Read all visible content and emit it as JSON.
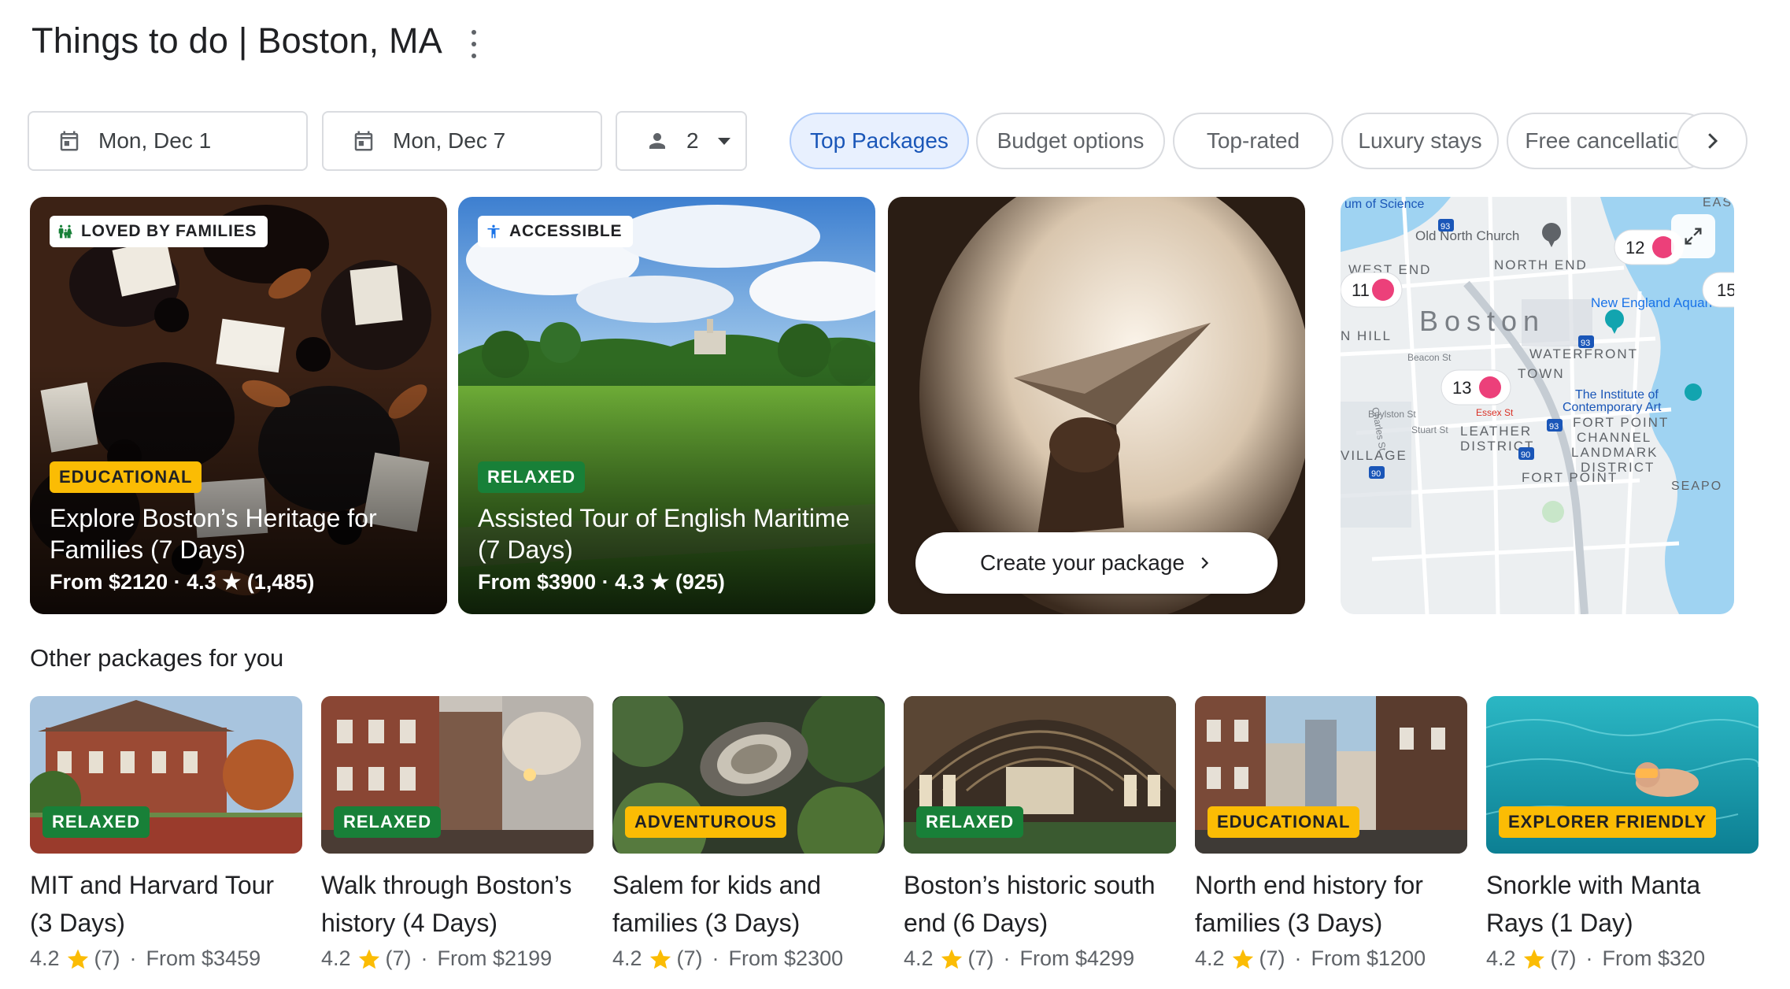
{
  "header": {
    "title": "Things to do | Boston, MA"
  },
  "filters": {
    "check_in": "Mon, Dec 1",
    "check_out": "Mon, Dec 7",
    "guests": "2",
    "chips": [
      "Top Packages",
      "Budget options",
      "Top-rated",
      "Luxury stays",
      "Free cancellation"
    ],
    "active_chip": "Top Packages"
  },
  "featured": [
    {
      "badge": "LOVED BY FAMILIES",
      "tag": "EDUCATIONAL",
      "title": "Explore Boston’s Heritage for Families (7 Days)",
      "meta": "From $2120 · 4.3 ★ (1,485)"
    },
    {
      "badge": "ACCESSIBLE",
      "tag": "RELAXED",
      "title": "Assisted Tour of English Maritime (7 Days)",
      "meta": "From $3900 · 4.3 ★ (925)"
    }
  ],
  "create_package": {
    "label": "Create your package"
  },
  "map": {
    "labels": {
      "museum": "um of Science",
      "church": "Old North Church",
      "west_end": "WEST END",
      "north_end": "NORTH END",
      "aquarium": "New England Aquari",
      "boston": "Boston",
      "n_hill": "N HILL",
      "waterfront": "WATERFRONT",
      "beacon": "Beacon St",
      "charles": "Charles St",
      "town": "TOWN",
      "ica1": "The Institute of",
      "ica2": "Contemporary Art",
      "boylston": "Boylston St",
      "essex": "Essex St",
      "stuart": "Stuart St",
      "leather1": "LEATHER",
      "leather2": "DISTRICT",
      "fort1": "FORT POINT",
      "fort2": "CHANNEL",
      "fort3": "LANDMARK",
      "fort4": "DISTRICT",
      "village": "VILLAGE",
      "fort_point": "FORT POINT",
      "east": "EAS",
      "seaport": "SEAPO"
    },
    "pins": [
      "12",
      "11",
      "13",
      "15"
    ],
    "highway_shields": [
      "93",
      "93",
      "93",
      "90",
      "90"
    ]
  },
  "other_section": {
    "title": "Other packages for you"
  },
  "packages": [
    {
      "tag": "RELAXED",
      "title": "MIT and Harvard Tour (3 Days)",
      "rating": "4.2",
      "reviews": "(7)",
      "price": "From $3459"
    },
    {
      "tag": "RELAXED",
      "title": "Walk through Boston’s history (4 Days)",
      "rating": "4.2",
      "reviews": "(7)",
      "price": "From $2199"
    },
    {
      "tag": "ADVENTUROUS",
      "title": "Salem for kids and families (3 Days)",
      "rating": "4.2",
      "reviews": "(7)",
      "price": "From $2300"
    },
    {
      "tag": "RELAXED",
      "title": "Boston’s historic south end (6 Days)",
      "rating": "4.2",
      "reviews": "(7)",
      "price": "From $4299"
    },
    {
      "tag": "EDUCATIONAL",
      "title": "North end history for families (3 Days)",
      "rating": "4.2",
      "reviews": "(7)",
      "price": "From $1200"
    },
    {
      "tag": "EXPLORER FRIENDLY",
      "title": "Snorkle with Manta Rays (1 Day)",
      "rating": "4.2",
      "reviews": "(7)",
      "price": "From $320"
    }
  ],
  "colors": {
    "accent_blue": "#1a73e8",
    "green_tag": "#188038",
    "yellow_tag": "#fbbc04",
    "star": "#fbbc04",
    "map_water": "#9fd3f2",
    "pin_pink": "#ec407a"
  }
}
